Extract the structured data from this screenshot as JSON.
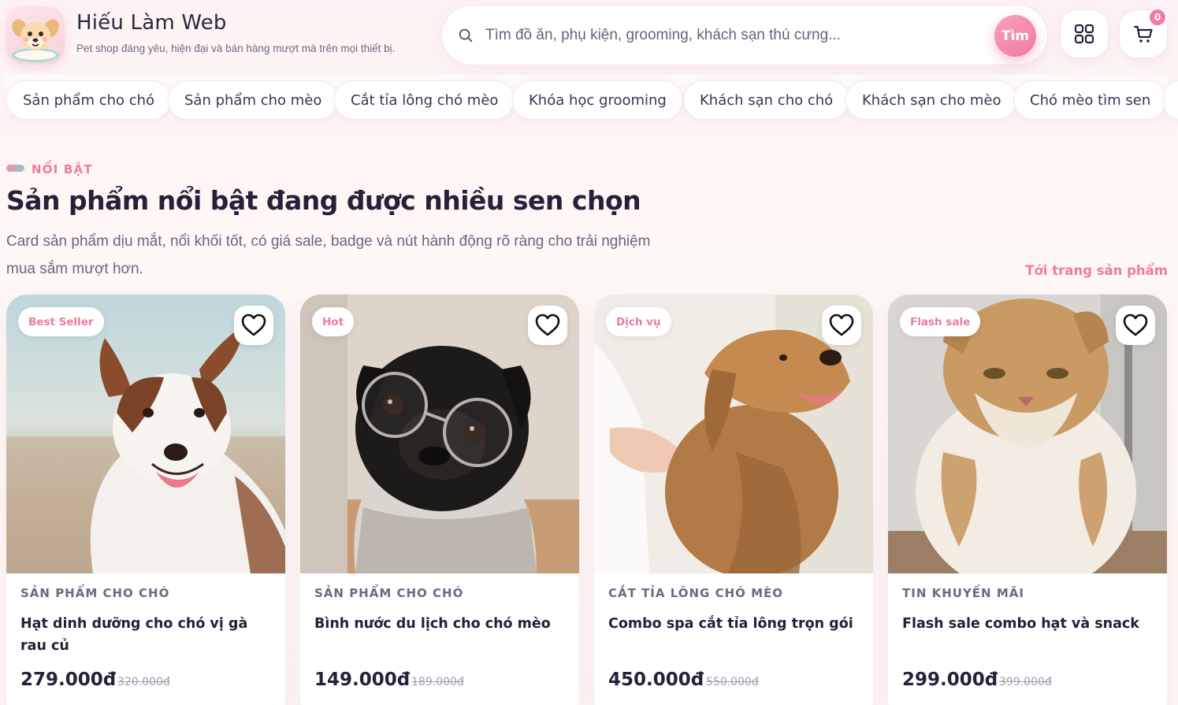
{
  "brand": {
    "name": "Hiếu Làm Web",
    "tagline": "Pet shop đáng yêu, hiện đại và bán hàng mượt mà trên mọi thiết bị."
  },
  "search": {
    "placeholder": "Tìm đồ ăn, phụ kiện, grooming, khách sạn thú cưng...",
    "button": "Tìm"
  },
  "cart": {
    "count": "0"
  },
  "categories": [
    "Sản phẩm cho chó",
    "Sản phẩm cho mèo",
    "Cắt tỉa lông chó mèo",
    "Khóa học grooming",
    "Khách sạn cho chó",
    "Khách sạn cho mèo",
    "Chó mèo tìm sen"
  ],
  "section": {
    "eyebrow": "NỔI BẬT",
    "title": "Sản phẩm nổi bật đang được nhiều sen chọn",
    "description": "Card sản phẩm dịu mắt, nổi khối tốt, có giá sale, badge và nút hành động rõ ràng cho trải nghiệm mua sắm mượt hơn.",
    "link": "Tới trang sản phẩm"
  },
  "products": [
    {
      "badge": "Best Seller",
      "category": "SẢN PHẨM CHO CHÓ",
      "name": "Hạt dinh dưỡng cho chó vị gà rau củ",
      "price": "279.000đ",
      "old_price": "320.000đ",
      "image": "border-collie-photo"
    },
    {
      "badge": "Hot",
      "category": "SẢN PHẨM CHO CHÓ",
      "name": "Bình nước du lịch cho chó mèo",
      "price": "149.000đ",
      "old_price": "189.000đ",
      "image": "pug-with-glasses-photo"
    },
    {
      "badge": "Dịch vụ",
      "category": "CẮT TỈA LÔNG CHÓ MÈO",
      "name": "Combo spa cắt tỉa lông trọn gói",
      "price": "450.000đ",
      "old_price": "550.000đ",
      "image": "golden-retriever-grooming-photo"
    },
    {
      "badge": "Flash sale",
      "category": "TIN KHUYẾN MÃI",
      "name": "Flash sale combo hạt và snack",
      "price": "299.000đ",
      "old_price": "399.000đ",
      "image": "persian-cat-photo"
    }
  ]
}
